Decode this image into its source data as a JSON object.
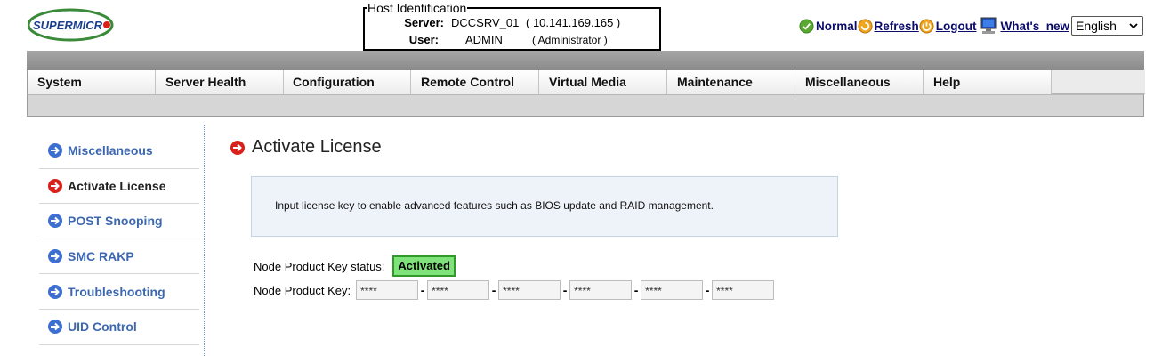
{
  "brand": {
    "logo_text": "SUPERMICR"
  },
  "host": {
    "legend": "Host Identification",
    "server_label": "Server:",
    "server_name": "DCCSRV_01",
    "server_ip": "( 10.141.169.165 )",
    "user_label": "User:",
    "user_name": "ADMIN",
    "user_role": "( Administrator )"
  },
  "top_right": {
    "status": "Normal",
    "refresh": "Refresh",
    "logout": "Logout",
    "whats_new": "What's_new",
    "language": "English"
  },
  "nav": {
    "tabs": [
      "System",
      "Server Health",
      "Configuration",
      "Remote Control",
      "Virtual Media",
      "Maintenance",
      "Miscellaneous",
      "Help"
    ]
  },
  "sidebar": {
    "items": [
      {
        "label": "Miscellaneous",
        "active": false
      },
      {
        "label": "Activate License",
        "active": true
      },
      {
        "label": "POST Snooping",
        "active": false
      },
      {
        "label": "SMC RAKP",
        "active": false
      },
      {
        "label": "Troubleshooting",
        "active": false
      },
      {
        "label": "UID Control",
        "active": false
      }
    ]
  },
  "main": {
    "title": "Activate License",
    "info": "Input license key to enable advanced features such as BIOS update and RAID management.",
    "status_label": "Node Product Key status:",
    "status_value": "Activated",
    "key_label": "Node Product Key:",
    "key_values": [
      "****",
      "****",
      "****",
      "****",
      "****",
      "****"
    ],
    "key_separator": "-"
  },
  "colors": {
    "accent": "#3d68b0",
    "active_arrow": "#d9211a",
    "status_green": "#7fe27a"
  }
}
